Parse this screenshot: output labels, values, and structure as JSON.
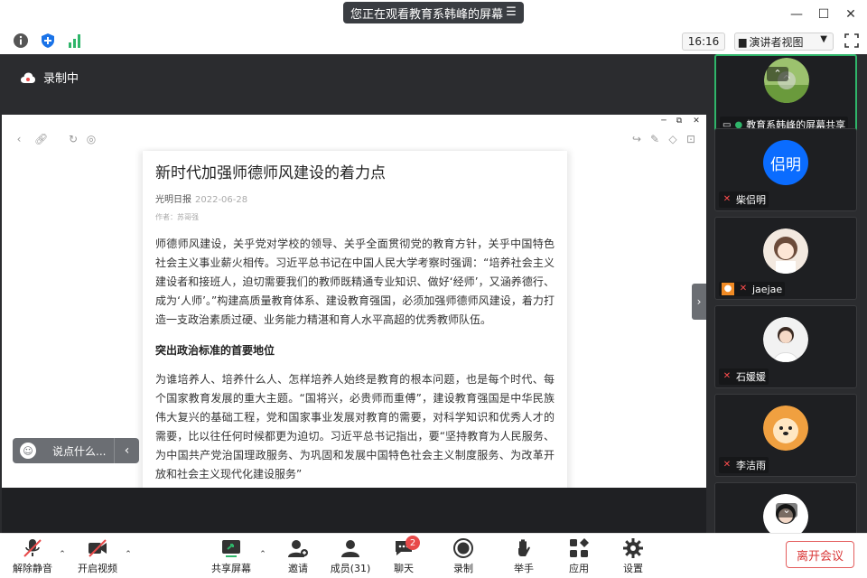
{
  "banner": {
    "text": "您正在观看教育系韩峰的屏幕"
  },
  "toolbar": {
    "time": "16:16",
    "view_label": "演讲者视图"
  },
  "stage": {
    "record_status": "录制中"
  },
  "article": {
    "title": "新时代加强师德师风建设的着力点",
    "source": "光明日报",
    "date": "2022-06-28",
    "author": "作者：苏哥强",
    "paragraph1": "师德师风建设，关乎党对学校的领导、关乎全面贯彻党的教育方针，关乎中国特色社会主义事业薪火相传。习近平总书记在中国人民大学考察时强调：“培养社会主义建设者和接班人，迫切需要我们的教师既精通专业知识、做好‘经师’，又涵养德行、成为‘人师’。”构建高质量教育体系、建设教育强国，必须加强师德师风建设，着力打造一支政治素质过硬、业务能力精湛和育人水平高超的优秀教师队伍。",
    "heading1": "突出政治标准的首要地位",
    "paragraph2": "为谁培养人、培养什么人、怎样培养人始终是教育的根本问题，也是每个时代、每个国家教育发展的重大主题。“国将兴，必贵师而重傅”，建设教育强国是中华民族伟大复兴的基础工程，党和国家事业发展对教育的需要，对科学知识和优秀人才的需要，比以往任何时候都更为迫切。习近平总书记指出，要“坚持教育为人民服务、为中国共产党治国理政服务、为巩固和发展中国特色社会主义制度服务、为改革开放和社会主义现代化建设服务”"
  },
  "comment": {
    "placeholder": "说点什么..."
  },
  "participants": [
    {
      "name": "教育系韩峰的屏幕共享",
      "type": "photo",
      "muted": false
    },
    {
      "name": "柴侣明",
      "type": "initials",
      "initials": "侣明",
      "muted": true
    },
    {
      "name": "jaejae",
      "type": "photo",
      "muted": true
    },
    {
      "name": "石媛媛",
      "type": "photo",
      "muted": true
    },
    {
      "name": "李洁雨",
      "type": "photo",
      "muted": true
    },
    {
      "name": "",
      "type": "photo",
      "muted": false
    }
  ],
  "controls": {
    "mute": "解除静音",
    "video": "开启视频",
    "share": "共享屏幕",
    "invite": "邀请",
    "members": "成员(31)",
    "chat": "聊天",
    "chat_badge": "2",
    "record": "录制",
    "raise_hand": "举手",
    "apps": "应用",
    "settings": "设置",
    "leave": "离开会议"
  },
  "colors": {
    "stage_bg": "#2b2c2f",
    "active_speaker": "#2fb56a",
    "leave_red": "#d93636",
    "avatar_blue": "#0a6cff"
  }
}
